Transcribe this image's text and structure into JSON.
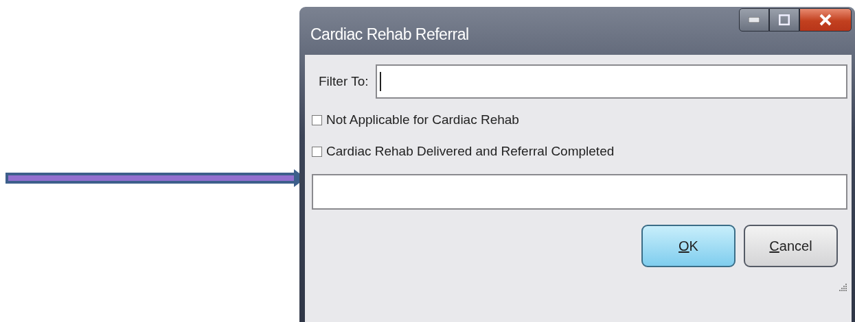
{
  "window": {
    "title": "Cardiac Rehab Referral"
  },
  "filter": {
    "label": "Filter To:"
  },
  "options": [
    {
      "label": "Not Applicable for Cardiac Rehab",
      "checked": false
    },
    {
      "label": "Cardiac Rehab Delivered and Referral Completed",
      "checked": false
    }
  ],
  "buttons": [
    {
      "label": "OK",
      "default": true
    },
    {
      "label": "Cancel",
      "default": false
    }
  ]
}
